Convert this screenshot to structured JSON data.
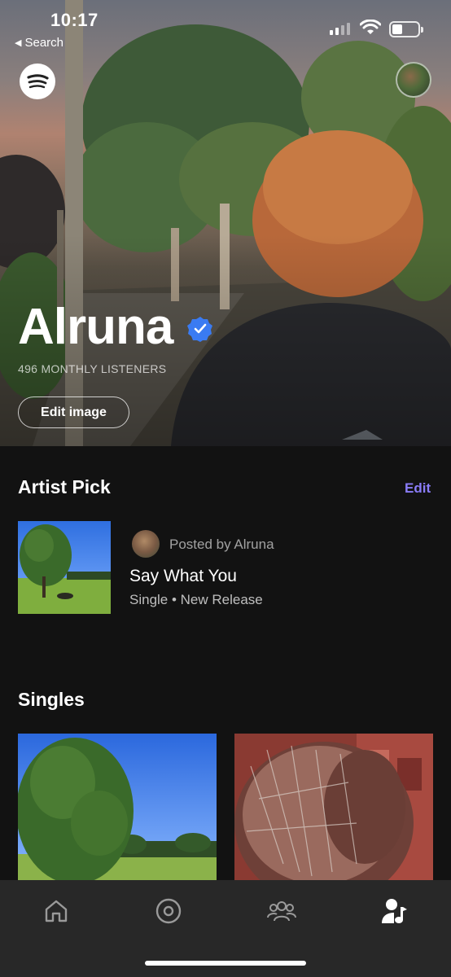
{
  "status_bar": {
    "time": "10:17",
    "back_label": "Search"
  },
  "hero": {
    "artist_name": "Alruna",
    "monthly_listeners": "496 MONTHLY LISTENERS",
    "edit_image_label": "Edit image",
    "verified": true
  },
  "artist_pick": {
    "section_title": "Artist Pick",
    "edit_label": "Edit",
    "posted_by": "Posted by Alruna",
    "title": "Say What You",
    "subtitle": "Single • New Release"
  },
  "singles": {
    "section_title": "Singles"
  },
  "tab_bar": {
    "items": [
      "home-icon",
      "radio-icon",
      "audience-icon",
      "artist-icon"
    ],
    "active": "artist-icon"
  },
  "colors": {
    "accent": "#8a7cf7",
    "verified_blue": "#3a7bf2",
    "background": "#121212",
    "tab_bar": "#282828"
  }
}
